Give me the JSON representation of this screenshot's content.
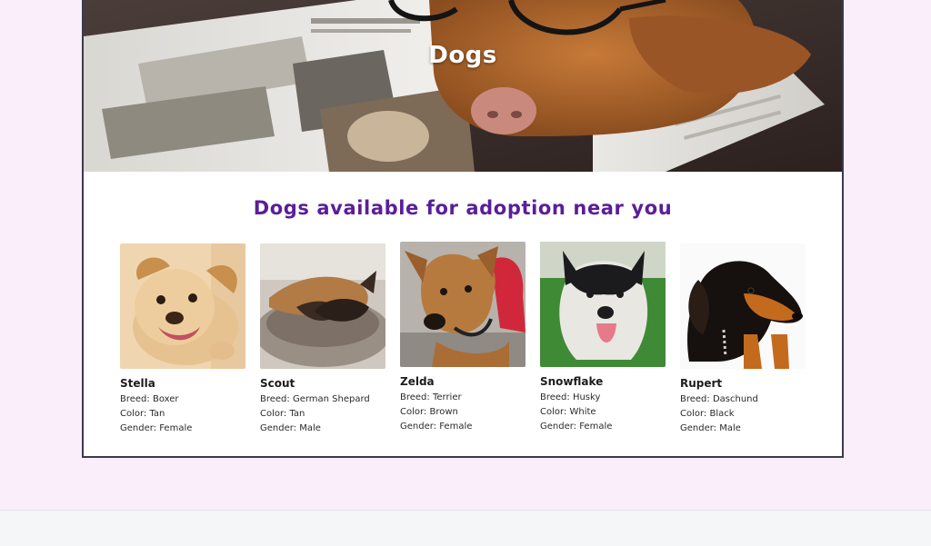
{
  "hero": {
    "title": "Dogs"
  },
  "section": {
    "heading": "Dogs available for adoption near you"
  },
  "dogs": [
    {
      "name": "Stella",
      "breed": "Breed: Boxer",
      "color": "Color: Tan",
      "gender": "Gender: Female",
      "photo": "tan-puppy-photo"
    },
    {
      "name": "Scout",
      "breed": "Breed: German Shepard",
      "color": "Color: Tan",
      "gender": "Gender: Male",
      "photo": "sleeping-shepherd-photo"
    },
    {
      "name": "Zelda",
      "breed": "Breed: Terrier",
      "color": "Color: Brown",
      "gender": "Gender: Female",
      "photo": "brown-terrier-photo"
    },
    {
      "name": "Snowflake",
      "breed": "Breed: Husky",
      "color": "Color: White",
      "gender": "Gender: Female",
      "photo": "husky-photo"
    },
    {
      "name": "Rupert",
      "breed": "Breed: Daschund",
      "color": "Color: Black",
      "gender": "Gender: Male",
      "photo": "dachshund-photo"
    }
  ],
  "colors": {
    "page_background": "#fbeefb",
    "heading_purple": "#5a1e9a",
    "card_border": "#3b3a4f"
  }
}
